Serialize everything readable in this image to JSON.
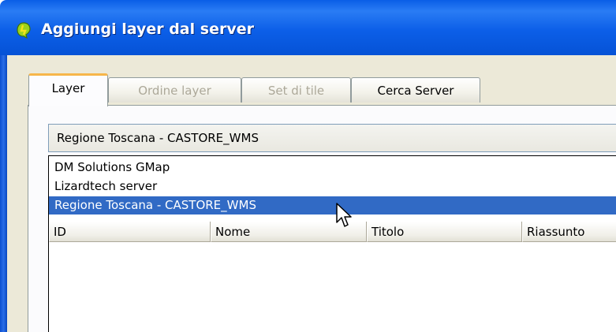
{
  "window": {
    "title": "Aggiungi layer dal server",
    "icon": "qgis-logo-icon"
  },
  "tabs": [
    {
      "label": "Layer",
      "active": true,
      "enabled": true
    },
    {
      "label": "Ordine layer",
      "active": false,
      "enabled": false
    },
    {
      "label": "Set di tile",
      "active": false,
      "enabled": false
    },
    {
      "label": "Cerca Server",
      "active": false,
      "enabled": true
    }
  ],
  "server_select": {
    "value": "Regione Toscana - CASTORE_WMS",
    "options": [
      {
        "label": "DM Solutions GMap",
        "selected": false
      },
      {
        "label": "Lizardtech server",
        "selected": false
      },
      {
        "label": "Regione Toscana - CASTORE_WMS",
        "selected": true
      }
    ]
  },
  "layers_table": {
    "columns": [
      "ID",
      "Nome",
      "Titolo",
      "Riassunto"
    ]
  },
  "colors": {
    "titlebar": "#0a5ee6",
    "selection": "#316ac5",
    "active_tab_accent": "#f7b64a",
    "dialog_background": "#ece9d8"
  }
}
